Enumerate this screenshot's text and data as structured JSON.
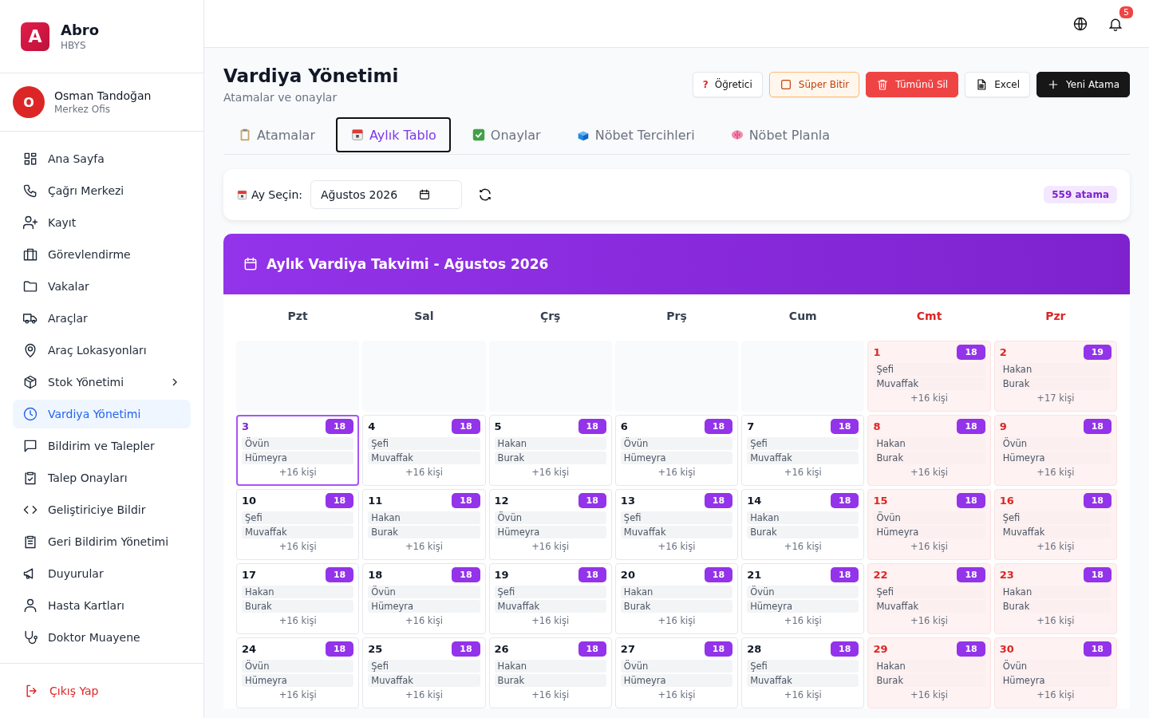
{
  "brand": {
    "logo": "A",
    "name": "Abro",
    "subtitle": "HBYS"
  },
  "user": {
    "initial": "O",
    "name": "Osman Tandoğan",
    "unit": "Merkez Ofis"
  },
  "nav": [
    {
      "label": "Ana Sayfa",
      "selected": false,
      "expandable": false
    },
    {
      "label": "Çağrı Merkezi",
      "selected": false,
      "expandable": false
    },
    {
      "label": "Kayıt",
      "selected": false,
      "expandable": false
    },
    {
      "label": "Görevlendirme",
      "selected": false,
      "expandable": false
    },
    {
      "label": "Vakalar",
      "selected": false,
      "expandable": false
    },
    {
      "label": "Araçlar",
      "selected": false,
      "expandable": false
    },
    {
      "label": "Araç Lokasyonları",
      "selected": false,
      "expandable": false
    },
    {
      "label": "Stok Yönetimi",
      "selected": false,
      "expandable": true
    },
    {
      "label": "Vardiya Yönetimi",
      "selected": true,
      "expandable": false
    },
    {
      "label": "Bildirim ve Talepler",
      "selected": false,
      "expandable": false
    },
    {
      "label": "Talep Onayları",
      "selected": false,
      "expandable": false
    },
    {
      "label": "Geliştiriciye Bildir",
      "selected": false,
      "expandable": false
    },
    {
      "label": "Geri Bildirim Yönetimi",
      "selected": false,
      "expandable": false
    },
    {
      "label": "Duyurular",
      "selected": false,
      "expandable": false
    },
    {
      "label": "Hasta Kartları",
      "selected": false,
      "expandable": false
    },
    {
      "label": "Doktor Muayene",
      "selected": false,
      "expandable": false
    }
  ],
  "logout": "Çıkış Yap",
  "topbar": {
    "notifications": "5"
  },
  "page": {
    "title": "Vardiya Yönetimi",
    "subtitle": "Atamalar ve onaylar"
  },
  "actions": [
    {
      "kind": "help",
      "icon_text": "?",
      "label": "Öğretici"
    },
    {
      "kind": "outline",
      "label": "Süper Bitir"
    },
    {
      "kind": "danger",
      "label": "Tümünü Sil"
    },
    {
      "kind": "excel",
      "label": "Excel"
    },
    {
      "kind": "primary",
      "label": "Yeni Atama"
    }
  ],
  "tabs": [
    {
      "label": "Atamalar",
      "selected": false
    },
    {
      "label": "Aylık Tablo",
      "selected": true
    },
    {
      "label": "Onaylar",
      "selected": false
    },
    {
      "label": "Nöbet Tercihleri",
      "selected": false
    },
    {
      "label": "Nöbet Planla",
      "selected": false
    }
  ],
  "filter": {
    "label": "Ay Seçin:",
    "value": "Ağustos 2026",
    "count": "559 atama"
  },
  "calendar": {
    "title": "Aylık Vardiya Takvimi - Ağustos 2026",
    "weekdays": [
      {
        "label": "Pzt",
        "weekend": false
      },
      {
        "label": "Sal",
        "weekend": false
      },
      {
        "label": "Çrş",
        "weekend": false
      },
      {
        "label": "Prş",
        "weekend": false
      },
      {
        "label": "Cum",
        "weekend": false
      },
      {
        "label": "Cmt",
        "weekend": true
      },
      {
        "label": "Pzr",
        "weekend": true
      }
    ],
    "cells": [
      {
        "kind": "empty"
      },
      {
        "kind": "empty"
      },
      {
        "kind": "empty"
      },
      {
        "kind": "empty"
      },
      {
        "kind": "empty"
      },
      {
        "kind": "day",
        "day": "1",
        "weekend": true,
        "selected": false,
        "count": "18",
        "names": [
          "Şefi",
          "Muvaffak"
        ],
        "more": "+16 kişi"
      },
      {
        "kind": "day",
        "day": "2",
        "weekend": true,
        "selected": false,
        "count": "19",
        "names": [
          "Hakan",
          "Burak"
        ],
        "more": "+17 kişi"
      },
      {
        "kind": "day",
        "day": "3",
        "weekend": false,
        "selected": true,
        "count": "18",
        "names": [
          "Övün",
          "Hümeyra"
        ],
        "more": "+16 kişi"
      },
      {
        "kind": "day",
        "day": "4",
        "weekend": false,
        "selected": false,
        "count": "18",
        "names": [
          "Şefi",
          "Muvaffak"
        ],
        "more": "+16 kişi"
      },
      {
        "kind": "day",
        "day": "5",
        "weekend": false,
        "selected": false,
        "count": "18",
        "names": [
          "Hakan",
          "Burak"
        ],
        "more": "+16 kişi"
      },
      {
        "kind": "day",
        "day": "6",
        "weekend": false,
        "selected": false,
        "count": "18",
        "names": [
          "Övün",
          "Hümeyra"
        ],
        "more": "+16 kişi"
      },
      {
        "kind": "day",
        "day": "7",
        "weekend": false,
        "selected": false,
        "count": "18",
        "names": [
          "Şefi",
          "Muvaffak"
        ],
        "more": "+16 kişi"
      },
      {
        "kind": "day",
        "day": "8",
        "weekend": true,
        "selected": false,
        "count": "18",
        "names": [
          "Hakan",
          "Burak"
        ],
        "more": "+16 kişi"
      },
      {
        "kind": "day",
        "day": "9",
        "weekend": true,
        "selected": false,
        "count": "18",
        "names": [
          "Övün",
          "Hümeyra"
        ],
        "more": "+16 kişi"
      },
      {
        "kind": "day",
        "day": "10",
        "weekend": false,
        "selected": false,
        "count": "18",
        "names": [
          "Şefi",
          "Muvaffak"
        ],
        "more": "+16 kişi"
      },
      {
        "kind": "day",
        "day": "11",
        "weekend": false,
        "selected": false,
        "count": "18",
        "names": [
          "Hakan",
          "Burak"
        ],
        "more": "+16 kişi"
      },
      {
        "kind": "day",
        "day": "12",
        "weekend": false,
        "selected": false,
        "count": "18",
        "names": [
          "Övün",
          "Hümeyra"
        ],
        "more": "+16 kişi"
      },
      {
        "kind": "day",
        "day": "13",
        "weekend": false,
        "selected": false,
        "count": "18",
        "names": [
          "Şefi",
          "Muvaffak"
        ],
        "more": "+16 kişi"
      },
      {
        "kind": "day",
        "day": "14",
        "weekend": false,
        "selected": false,
        "count": "18",
        "names": [
          "Hakan",
          "Burak"
        ],
        "more": "+16 kişi"
      },
      {
        "kind": "day",
        "day": "15",
        "weekend": true,
        "selected": false,
        "count": "18",
        "names": [
          "Övün",
          "Hümeyra"
        ],
        "more": "+16 kişi"
      },
      {
        "kind": "day",
        "day": "16",
        "weekend": true,
        "selected": false,
        "count": "18",
        "names": [
          "Şefi",
          "Muvaffak"
        ],
        "more": "+16 kişi"
      },
      {
        "kind": "day",
        "day": "17",
        "weekend": false,
        "selected": false,
        "count": "18",
        "names": [
          "Hakan",
          "Burak"
        ],
        "more": "+16 kişi"
      },
      {
        "kind": "day",
        "day": "18",
        "weekend": false,
        "selected": false,
        "count": "18",
        "names": [
          "Övün",
          "Hümeyra"
        ],
        "more": "+16 kişi"
      },
      {
        "kind": "day",
        "day": "19",
        "weekend": false,
        "selected": false,
        "count": "18",
        "names": [
          "Şefi",
          "Muvaffak"
        ],
        "more": "+16 kişi"
      },
      {
        "kind": "day",
        "day": "20",
        "weekend": false,
        "selected": false,
        "count": "18",
        "names": [
          "Hakan",
          "Burak"
        ],
        "more": "+16 kişi"
      },
      {
        "kind": "day",
        "day": "21",
        "weekend": false,
        "selected": false,
        "count": "18",
        "names": [
          "Övün",
          "Hümeyra"
        ],
        "more": "+16 kişi"
      },
      {
        "kind": "day",
        "day": "22",
        "weekend": true,
        "selected": false,
        "count": "18",
        "names": [
          "Şefi",
          "Muvaffak"
        ],
        "more": "+16 kişi"
      },
      {
        "kind": "day",
        "day": "23",
        "weekend": true,
        "selected": false,
        "count": "18",
        "names": [
          "Hakan",
          "Burak"
        ],
        "more": "+16 kişi"
      },
      {
        "kind": "day",
        "day": "24",
        "weekend": false,
        "selected": false,
        "count": "18",
        "names": [
          "Övün",
          "Hümeyra"
        ],
        "more": "+16 kişi"
      },
      {
        "kind": "day",
        "day": "25",
        "weekend": false,
        "selected": false,
        "count": "18",
        "names": [
          "Şefi",
          "Muvaffak"
        ],
        "more": "+16 kişi"
      },
      {
        "kind": "day",
        "day": "26",
        "weekend": false,
        "selected": false,
        "count": "18",
        "names": [
          "Hakan",
          "Burak"
        ],
        "more": "+16 kişi"
      },
      {
        "kind": "day",
        "day": "27",
        "weekend": false,
        "selected": false,
        "count": "18",
        "names": [
          "Övün",
          "Hümeyra"
        ],
        "more": "+16 kişi"
      },
      {
        "kind": "day",
        "day": "28",
        "weekend": false,
        "selected": false,
        "count": "18",
        "names": [
          "Şefi",
          "Muvaffak"
        ],
        "more": "+16 kişi"
      },
      {
        "kind": "day",
        "day": "29",
        "weekend": true,
        "selected": false,
        "count": "18",
        "names": [
          "Hakan",
          "Burak"
        ],
        "more": "+16 kişi"
      },
      {
        "kind": "day",
        "day": "30",
        "weekend": true,
        "selected": false,
        "count": "18",
        "names": [
          "Övün",
          "Hümeyra"
        ],
        "more": "+16 kişi"
      }
    ]
  }
}
